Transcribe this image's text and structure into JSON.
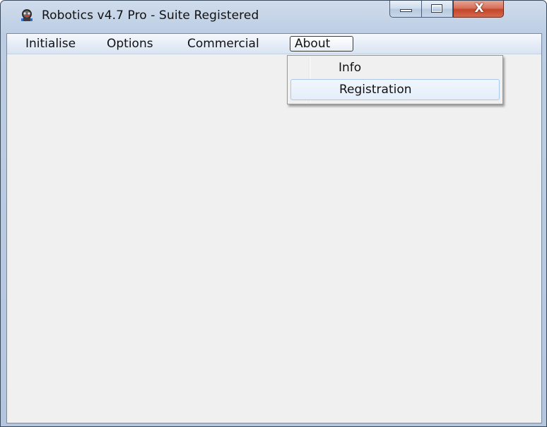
{
  "window": {
    "title": "Robotics v4.7 Pro - Suite Registered",
    "app_icon": "robot-icon",
    "caption_buttons": {
      "minimize": "minimize-icon",
      "maximize": "maximize-icon",
      "close": "X"
    }
  },
  "menubar": {
    "items": [
      {
        "label": "Initialise"
      },
      {
        "label": "Options"
      },
      {
        "label": "Commercial"
      },
      {
        "label": "About",
        "active": true
      }
    ]
  },
  "about_menu": {
    "items": [
      {
        "label": "Info"
      },
      {
        "label": "Registration",
        "highlighted": true
      }
    ]
  },
  "colors": {
    "window_frame": "#b4c6de",
    "client_background": "#f0f0f0",
    "close_button": "#c4452b",
    "highlight_border": "#a8c8ec"
  }
}
